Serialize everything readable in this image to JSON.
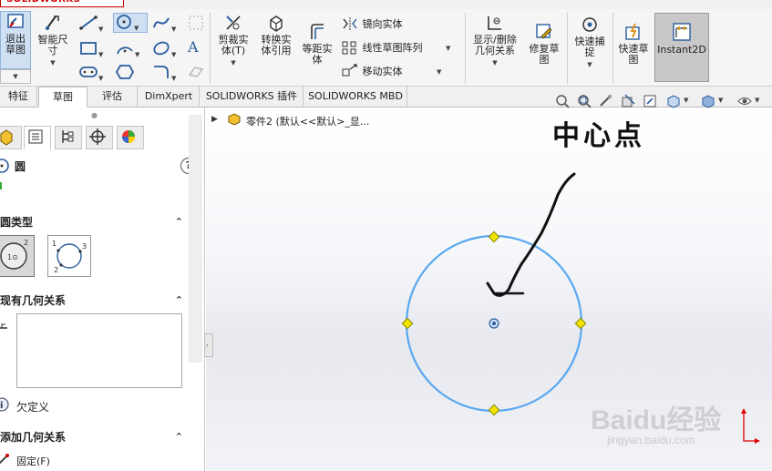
{
  "app": {
    "logo_text": "SOLIDWORKS"
  },
  "ribbon": {
    "exit_sketch": "退出草图",
    "smart_dimension": "智能尺寸",
    "trim": "剪裁实体(T)",
    "convert": "转换实体引用",
    "offset": "等距实体",
    "mirror": "镜向实体",
    "linear_pattern": "线性草图阵列",
    "move": "移动实体",
    "display_relations": "显示/删除几何关系",
    "repair_sketch": "修复草图",
    "quick_snaps": "快速捕捉",
    "rapid_sketch": "快速草图",
    "instant2d": "Instant2D"
  },
  "tabs": [
    {
      "label": "特征"
    },
    {
      "label": "草图"
    },
    {
      "label": "评估"
    },
    {
      "label": "DimXpert"
    },
    {
      "label": "SOLIDWORKS 插件"
    },
    {
      "label": "SOLIDWORKS MBD"
    }
  ],
  "active_tab": "草图",
  "panel": {
    "title": "圆",
    "help": "?",
    "section_circle_type": "圆类型",
    "section_existing_relations": "现有几何关系",
    "status_text": "欠定义",
    "section_add_relations": "添加几何关系",
    "fix_label": "固定(F)"
  },
  "tree": {
    "part_label": "零件2  (默认<<默认>_显..."
  },
  "annotation": {
    "text": "中心点"
  },
  "watermark": {
    "brand": "Baidu经验",
    "url": "jingyan.baidu.com"
  },
  "colors": {
    "circle": "#5aa8f0",
    "handle_point": "#f2e400",
    "accent_active": "#c9d9ee"
  }
}
